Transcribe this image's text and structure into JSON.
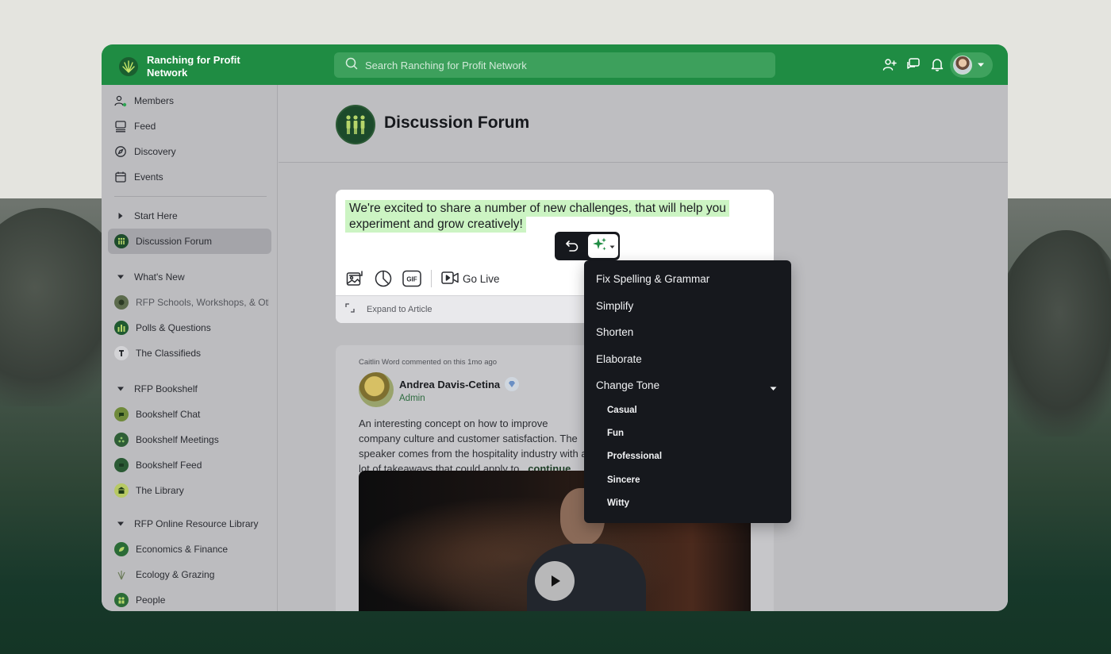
{
  "topbar": {
    "brand_name": "Ranching for Profit Network",
    "search_placeholder": "Search Ranching for Profit Network",
    "icons": [
      "add-user-icon",
      "chat-icon",
      "bell-icon",
      "avatar",
      "chevron-down-icon"
    ]
  },
  "sidebar": {
    "primary": [
      {
        "label": "Members",
        "icon": "members-icon"
      },
      {
        "label": "Feed",
        "icon": "feed-icon"
      },
      {
        "label": "Discovery",
        "icon": "compass-icon"
      },
      {
        "label": "Events",
        "icon": "calendar-icon"
      }
    ],
    "start_here": "Start Here",
    "discussion_forum": "Discussion Forum",
    "whats_new": {
      "title": "What's New",
      "items": [
        "RFP Schools, Workshops, & Other Events",
        "Polls & Questions",
        "The Classifieds"
      ]
    },
    "bookshelf": {
      "title": "RFP Bookshelf",
      "items": [
        "Bookshelf Chat",
        "Bookshelf Meetings",
        "Bookshelf Feed",
        "The Library"
      ]
    },
    "online_library": {
      "title": "RFP Online Resource Library",
      "items": [
        "Economics & Finance",
        "Ecology & Grazing",
        "People"
      ]
    }
  },
  "forum": {
    "title": "Discussion Forum"
  },
  "composer": {
    "text": "We're excited to share a number of new challenges, that will help you experiment and grow creatively!",
    "go_live": "Go Live",
    "gif": "GIF",
    "expand": "Expand to Article"
  },
  "post": {
    "meta": "Caitlin Word commented on this 1mo ago",
    "author": "Andrea Davis-Cetina",
    "role": "Admin",
    "body": "An interesting concept on how to improve company culture and customer satisfaction. The speaker comes from the hospitality industry with a lot of takeaways that could apply to",
    "continue": "...continue"
  },
  "ai_menu": {
    "items": [
      "Fix Spelling & Grammar",
      "Simplify",
      "Shorten",
      "Elaborate"
    ],
    "change_tone": "Change Tone",
    "tones": [
      "Casual",
      "Fun",
      "Professional",
      "Sincere",
      "Witty"
    ],
    "accent": "#1f8c43"
  }
}
